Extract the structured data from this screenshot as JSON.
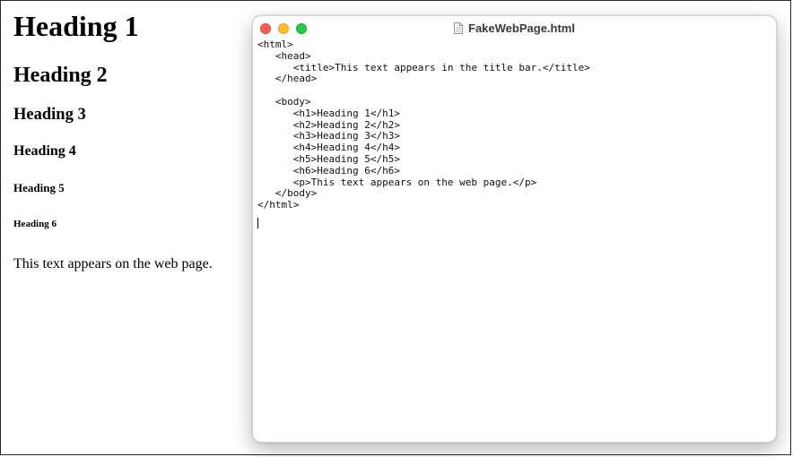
{
  "rendered_page": {
    "h1": "Heading 1",
    "h2": "Heading 2",
    "h3": "Heading 3",
    "h4": "Heading 4",
    "h5": "Heading 5",
    "h6": "Heading 6",
    "paragraph": "This text appears on the web page."
  },
  "editor_window": {
    "title": "FakeWebPage.html",
    "file_icon": "document-icon",
    "traffic_lights": {
      "close": "#ff5f57",
      "minimize": "#febc2e",
      "maximize": "#28c840"
    },
    "code_lines": [
      "<html>",
      "   <head>",
      "      <title>This text appears in the title bar.</title>",
      "   </head>",
      "",
      "   <body>",
      "      <h1>Heading 1</h1>",
      "      <h2>Heading 2</h2>",
      "      <h3>Heading 3</h3>",
      "      <h4>Heading 4</h4>",
      "      <h5>Heading 5</h5>",
      "      <h6>Heading 6</h6>",
      "      <p>This text appears on the web page.</p>",
      "   </body>",
      "</html>"
    ]
  }
}
